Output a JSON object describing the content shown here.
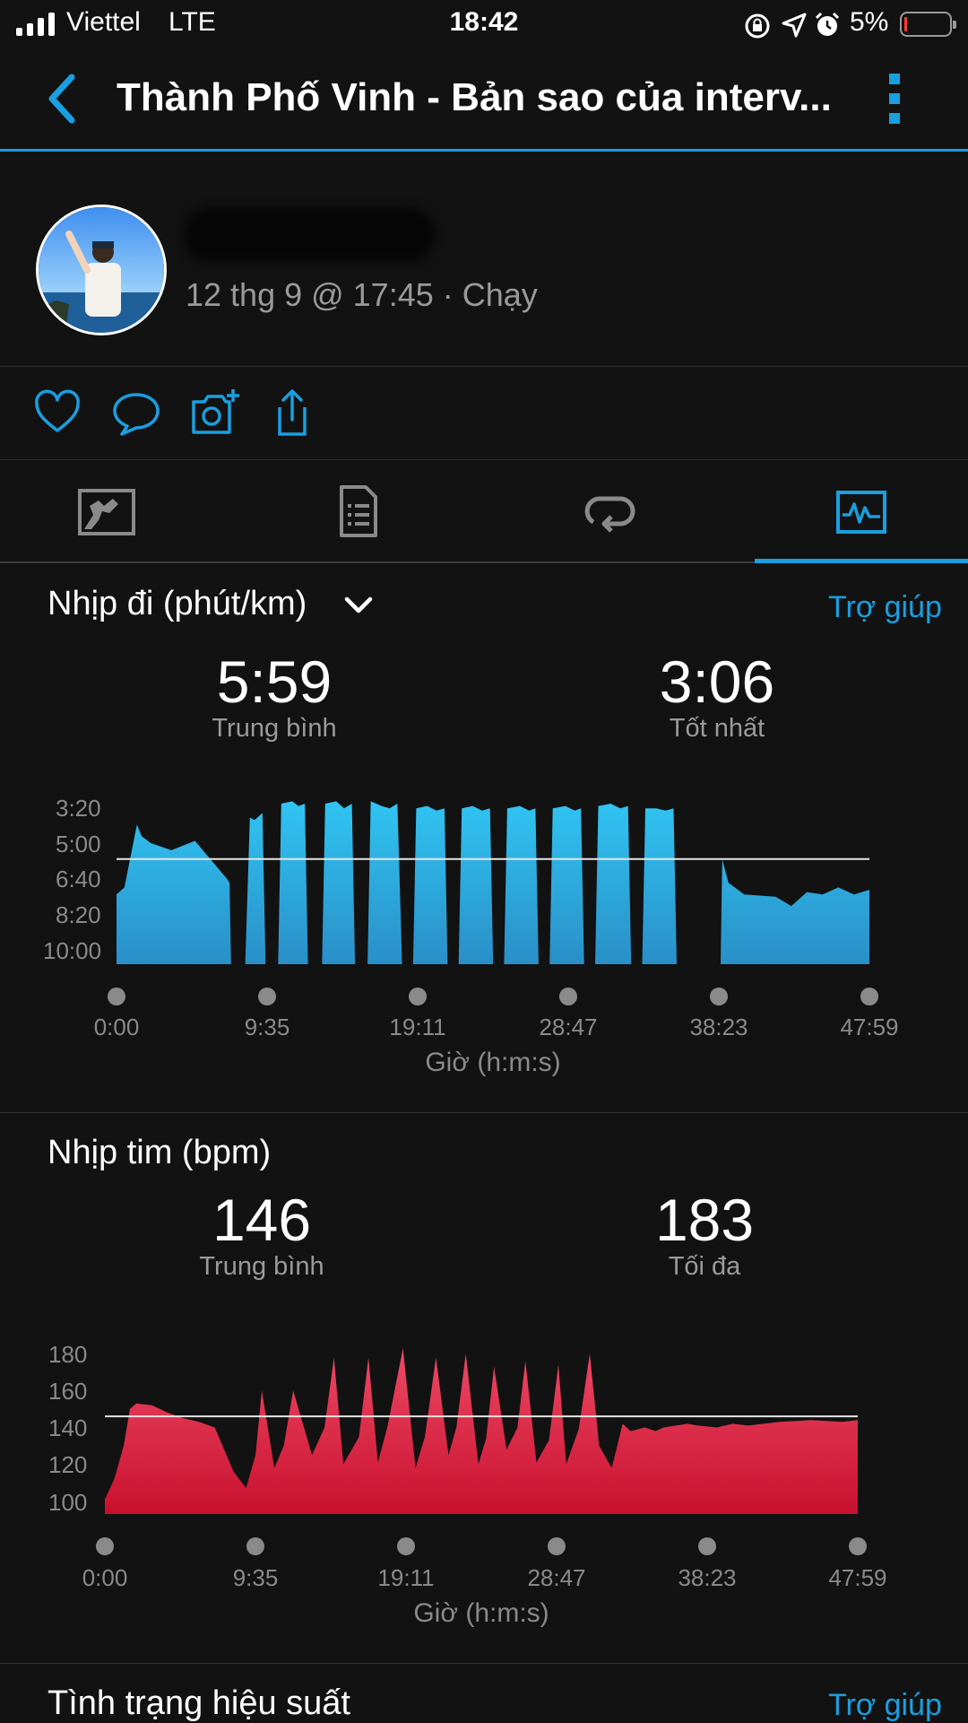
{
  "status_bar": {
    "carrier": "Viettel",
    "network": "LTE",
    "time": "18:42",
    "battery": "5%"
  },
  "header": {
    "title": "Thành Phố Vinh - Bản sao của interv..."
  },
  "profile": {
    "subtitle": "12 thg 9 @ 17:45 · Chạy"
  },
  "pace": {
    "title": "Nhịp đi (phút/km)",
    "help": "Trợ giúp",
    "avg_value": "5:59",
    "avg_label": "Trung bình",
    "best_value": "3:06",
    "best_label": "Tốt nhất",
    "y_ticks": [
      "3:20",
      "5:00",
      "6:40",
      "8:20",
      "10:00"
    ],
    "x_ticks": [
      "0:00",
      "9:35",
      "19:11",
      "28:47",
      "38:23",
      "47:59"
    ],
    "x_label": "Giờ (h:m:s)"
  },
  "hr": {
    "title": "Nhịp tim (bpm)",
    "avg_value": "146",
    "avg_label": "Trung bình",
    "max_value": "183",
    "max_label": "Tối đa",
    "y_ticks": [
      "180",
      "160",
      "140",
      "120",
      "100"
    ],
    "x_ticks": [
      "0:00",
      "9:35",
      "19:11",
      "28:47",
      "38:23",
      "47:59"
    ],
    "x_label": "Giờ (h:m:s)"
  },
  "performance": {
    "title": "Tình trạng hiệu suất",
    "help": "Trợ giúp"
  },
  "colors": {
    "accent": "#1a9fe0",
    "pace_fill": "#2ab8ec",
    "hr_fill": "#e8294a"
  },
  "chart_data": [
    {
      "type": "area",
      "title": "Nhịp đi (phút/km)",
      "xlabel": "Giờ (h:m:s)",
      "x_unit": "minutes",
      "y_unit": "min/km",
      "x_ticks": [
        "0:00",
        "9:35",
        "19:11",
        "28:47",
        "38:23",
        "47:59"
      ],
      "y_ticks": [
        "3:20",
        "5:00",
        "6:40",
        "8:20",
        "10:00"
      ],
      "xlim": [
        0,
        47.98
      ],
      "ylim": [
        10.5,
        3.33
      ],
      "average_line": 5.98,
      "series": [
        {
          "x": [
            0,
            0.5,
            1.3,
            1.6,
            2.2,
            3.5,
            5.0,
            6.0,
            7.0,
            7.2,
            7.3,
            8.2,
            8.5,
            8.8,
            9.3,
            9.5,
            10.3,
            10.5,
            11.2,
            11.6,
            12.0,
            12.2,
            13.1,
            13.3,
            14.0,
            14.5,
            15.0,
            15.2,
            16.0,
            16.2,
            16.9,
            17.4,
            17.9,
            18.2,
            18.9,
            19.1,
            19.8,
            20.4,
            20.9,
            21.1,
            21.8,
            22.0,
            22.7,
            23.3,
            23.8,
            24.0,
            24.7,
            24.9,
            25.7,
            26.3,
            26.7,
            26.9,
            27.6,
            27.8,
            28.6,
            29.2,
            29.6,
            29.8,
            30.5,
            30.7,
            31.5,
            32.1,
            32.6,
            32.8,
            33.5,
            33.7,
            34.4,
            35.0,
            35.5,
            35.7,
            36.5,
            38.5,
            38.6,
            39.0,
            40.0,
            42.0,
            43.0,
            44.0,
            45.0,
            46.0,
            47.0,
            47.98
          ],
          "y": [
            7.5,
            7.2,
            4.5,
            5.0,
            5.3,
            5.6,
            5.2,
            6.0,
            6.8,
            7.0,
            10.5,
            10.5,
            4.2,
            4.3,
            4.0,
            10.5,
            10.5,
            3.6,
            3.5,
            3.7,
            3.6,
            10.5,
            10.5,
            3.6,
            3.5,
            3.8,
            3.6,
            10.5,
            10.5,
            3.5,
            3.7,
            3.8,
            3.6,
            10.5,
            10.5,
            3.8,
            3.7,
            3.9,
            3.8,
            10.5,
            10.5,
            3.8,
            3.7,
            3.9,
            3.8,
            10.5,
            10.5,
            3.8,
            3.7,
            3.9,
            3.8,
            10.5,
            10.5,
            3.8,
            3.7,
            3.9,
            3.8,
            10.5,
            10.5,
            3.7,
            3.6,
            3.8,
            3.7,
            10.5,
            10.5,
            3.8,
            3.8,
            3.9,
            3.8,
            10.5,
            10.5,
            10.5,
            6.0,
            7.0,
            7.5,
            7.6,
            8.0,
            7.4,
            7.5,
            7.2,
            7.5,
            7.3
          ]
        }
      ]
    },
    {
      "type": "area",
      "title": "Nhịp tim (bpm)",
      "xlabel": "Giờ (h:m:s)",
      "x_unit": "minutes",
      "y_unit": "bpm",
      "x_ticks": [
        "0:00",
        "9:35",
        "19:11",
        "28:47",
        "38:23",
        "47:59"
      ],
      "y_ticks": [
        "180",
        "160",
        "140",
        "120",
        "100"
      ],
      "xlim": [
        0,
        47.98
      ],
      "ylim": [
        93,
        186
      ],
      "average_line": 146,
      "series": [
        {
          "x": [
            0,
            0.6,
            1.2,
            1.6,
            2.0,
            3.0,
            4.0,
            5.0,
            6.0,
            7.0,
            7.6,
            8.2,
            9.0,
            9.6,
            10.0,
            10.8,
            11.4,
            12.0,
            13.2,
            14.0,
            14.6,
            15.2,
            16.2,
            16.8,
            17.4,
            18.0,
            19.0,
            19.8,
            20.4,
            21.1,
            21.9,
            22.4,
            23.0,
            23.8,
            24.3,
            24.8,
            25.6,
            26.3,
            26.8,
            27.5,
            28.3,
            28.9,
            29.4,
            30.2,
            30.9,
            31.5,
            32.3,
            33.0,
            33.5,
            34.4,
            35.1,
            35.6,
            36.4,
            37.1,
            37.8,
            39.0,
            40.0,
            41.0,
            43.0,
            45.0,
            47.0,
            47.98
          ],
          "y": [
            101,
            112,
            130,
            150,
            153,
            152,
            148,
            145,
            143,
            140,
            128,
            116,
            107,
            125,
            160,
            118,
            130,
            160,
            125,
            140,
            178,
            120,
            135,
            178,
            121,
            140,
            183,
            118,
            135,
            178,
            125,
            140,
            180,
            120,
            134,
            173,
            128,
            140,
            176,
            121,
            133,
            174,
            120,
            139,
            180,
            130,
            118,
            142,
            138,
            140,
            138,
            140,
            141,
            142,
            141,
            140,
            142,
            141,
            143,
            144,
            143,
            144
          ]
        }
      ]
    }
  ]
}
